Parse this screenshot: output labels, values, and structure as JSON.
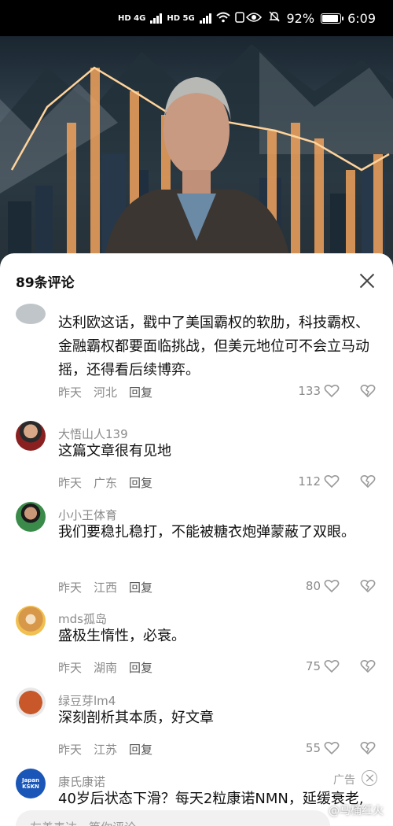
{
  "status_bar": {
    "network_left": "HD 4G",
    "network_right": "HD 5G",
    "battery": "92%",
    "battery_level": 0.92,
    "time": "6:09"
  },
  "sheet": {
    "title": "89条评论"
  },
  "comments": [
    {
      "text": "达利欧这话，戳中了美国霸权的软肋，科技霸权、金融霸权都要面临挑战，但美元地位可不会立马动摇，还得看后续博弈。",
      "time": "昨天",
      "location": "河北",
      "reply": "回复",
      "likes": "133"
    },
    {
      "name": "大悟山人139",
      "text": "这篇文章很有见地",
      "time": "昨天",
      "location": "广东",
      "reply": "回复",
      "likes": "112"
    },
    {
      "name": "小小王体育",
      "text": "我们要稳扎稳打，不能被糖衣炮弹蒙蔽了双眼。",
      "time": "昨天",
      "location": "江西",
      "reply": "回复",
      "likes": "80"
    },
    {
      "name": "mds孤岛",
      "text": "盛极生惰性，必衰。",
      "time": "昨天",
      "location": "湖南",
      "reply": "回复",
      "likes": "75"
    },
    {
      "name": "绿豆芽lm4",
      "text": "深刻剖析其本质，好文章",
      "time": "昨天",
      "location": "江苏",
      "reply": "回复",
      "likes": "55"
    }
  ],
  "ad": {
    "name": "康氏康诺",
    "tag": "广告",
    "text": "40岁后状态下滑？每天2粒康诺NMN，延缓衰老,",
    "logo_text": "Japan KSKN"
  },
  "input": {
    "placeholder": "友善表达，等你评论"
  },
  "watermark": "@马桶红火",
  "colors": {
    "meta_gray": "#8a8a8a",
    "ad_logo_blue": "#1a56b8"
  }
}
